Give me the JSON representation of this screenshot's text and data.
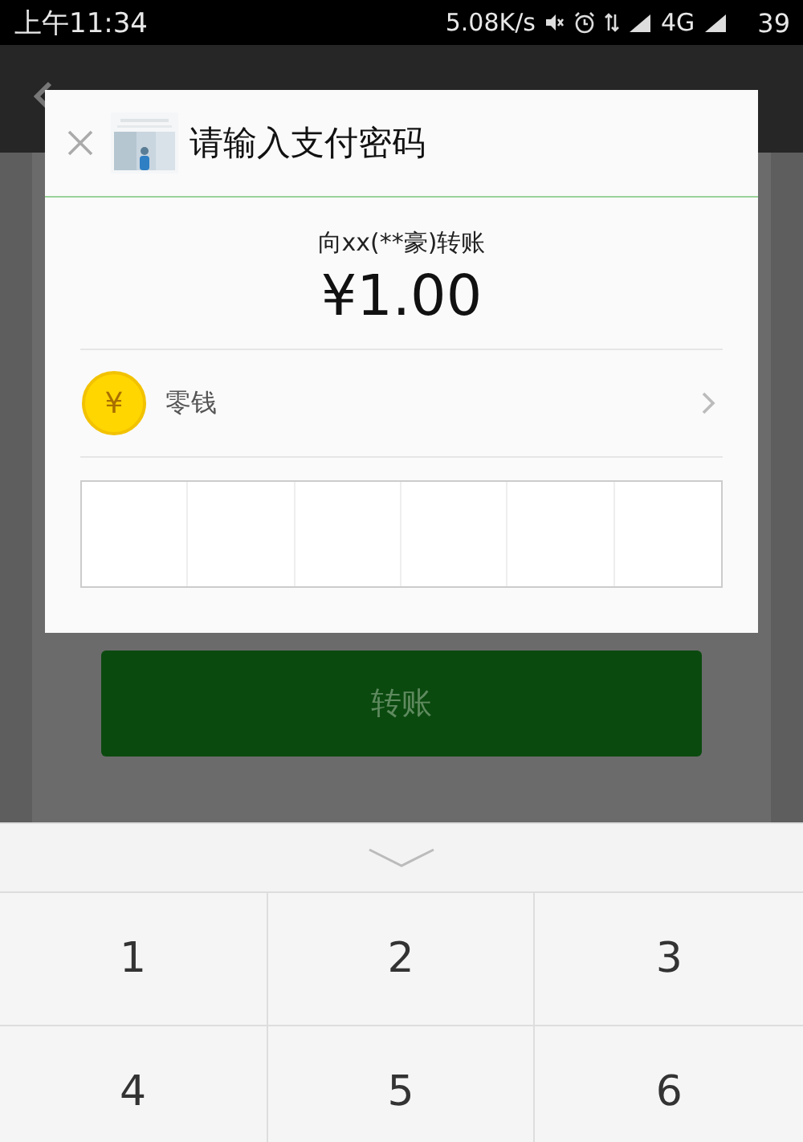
{
  "status_bar": {
    "time": "上午11:34",
    "network_speed": "5.08K/s",
    "network_type": "4G",
    "battery": "39"
  },
  "dialog": {
    "title": "请输入支付密码",
    "payee": "向xx(**豪)转账",
    "amount": "¥1.00",
    "payment_method": {
      "icon_symbol": "¥",
      "label": "零钱"
    }
  },
  "transfer_button": {
    "label": "转账",
    "disabled": true
  },
  "keypad": {
    "keys": [
      "1",
      "2",
      "3",
      "4",
      "5",
      "6"
    ]
  }
}
